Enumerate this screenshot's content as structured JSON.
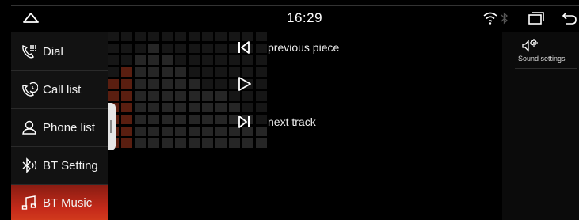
{
  "status": {
    "time": "16:29"
  },
  "sidebar": {
    "items": [
      {
        "label": "Dial",
        "icon": "phone-dialpad-icon",
        "active": false
      },
      {
        "label": "Call list",
        "icon": "call-history-icon",
        "active": false
      },
      {
        "label": "Phone list",
        "icon": "contact-icon",
        "active": false
      },
      {
        "label": "BT Setting",
        "icon": "bluetooth-icon",
        "active": false
      },
      {
        "label": "BT Music",
        "icon": "music-note-icon",
        "active": true
      }
    ]
  },
  "player": {
    "previous_label": "previous piece",
    "next_label": "next track"
  },
  "right_panel": {
    "sound_settings_label": "Sound settings"
  },
  "colors": {
    "accent": "#c62b1a",
    "background": "#000000"
  }
}
